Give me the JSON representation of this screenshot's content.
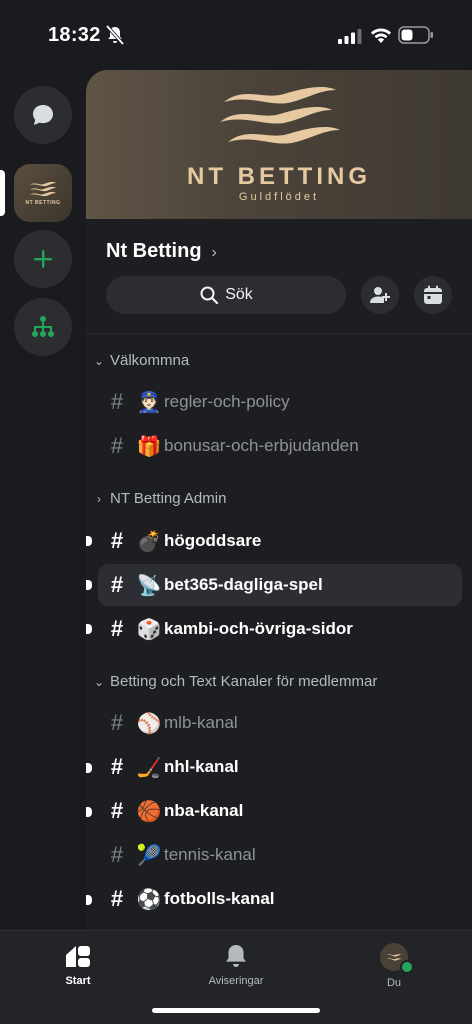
{
  "status_bar": {
    "time": "18:32"
  },
  "server": {
    "name": "Nt Betting",
    "banner_title": "NT BETTING",
    "banner_subtitle": "Guldflödet"
  },
  "search": {
    "label": "Sök"
  },
  "categories": [
    {
      "name": "Välkommna",
      "expanded": true,
      "channels": [
        {
          "emoji": "👮🏻",
          "name": "regler-och-policy",
          "unread": false
        },
        {
          "emoji": "🎁",
          "name": "bonusar-och-erbjudanden",
          "unread": false
        }
      ]
    },
    {
      "name": "NT Betting Admin",
      "expanded": false,
      "channels": [
        {
          "emoji": "💣",
          "name": "högoddsare",
          "unread": true
        },
        {
          "emoji": "📡",
          "name": "bet365-dagliga-spel",
          "unread": true,
          "selected": true
        },
        {
          "emoji": "🎲",
          "name": "kambi-och-övriga-sidor",
          "unread": true
        }
      ]
    },
    {
      "name": "Betting och Text Kanaler för medlemmar",
      "expanded": true,
      "channels": [
        {
          "emoji": "⚾",
          "name": "mlb-kanal",
          "unread": false
        },
        {
          "emoji": "🏒",
          "name": "nhl-kanal",
          "unread": true
        },
        {
          "emoji": "🏀",
          "name": "nba-kanal",
          "unread": true
        },
        {
          "emoji": "🎾",
          "name": "tennis-kanal",
          "unread": false
        },
        {
          "emoji": "⚽",
          "name": "fotbolls-kanal",
          "unread": true
        }
      ]
    }
  ],
  "bottom_nav": {
    "start": "Start",
    "notifications": "Aviseringar",
    "you": "Du"
  },
  "colors": {
    "online": "#23a55a",
    "add_green": "#23a55a",
    "banner_gold": "#e6c9a0"
  }
}
